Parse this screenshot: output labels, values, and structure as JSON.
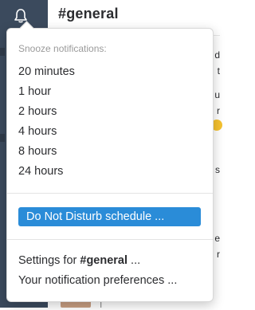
{
  "channel": {
    "title": "#general"
  },
  "menu": {
    "header": "Snooze notifications:",
    "snooze_options": [
      "20 minutes",
      "1 hour",
      "2 hours",
      "4 hours",
      "8 hours",
      "24 hours"
    ],
    "dnd_schedule": "Do Not Disturb schedule ...",
    "settings_prefix": "Settings for ",
    "settings_channel": "#general",
    "settings_suffix": " ...",
    "preferences": "Your notification preferences ..."
  },
  "colors": {
    "sidebar": "#3b4a5d",
    "highlight": "#2a8cd8"
  }
}
